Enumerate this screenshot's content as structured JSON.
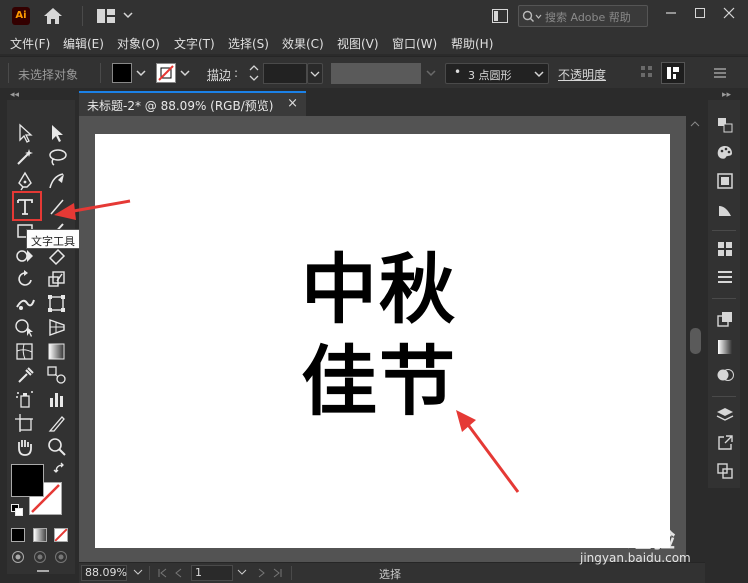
{
  "app": {
    "logo_text": "Ai"
  },
  "search": {
    "placeholder": "搜索 Adobe 帮助"
  },
  "menu": [
    "文件(F)",
    "编辑(E)",
    "对象(O)",
    "文字(T)",
    "选择(S)",
    "效果(C)",
    "视图(V)",
    "窗口(W)",
    "帮助(H)"
  ],
  "control_bar": {
    "selection_status": "未选择对象",
    "stroke_label": "描边",
    "stroke_separator": ":",
    "brush_label": "3 点圆形",
    "brush_dot": "•",
    "opacity_label": "不透明度"
  },
  "tooltip": {
    "text": "文字工具 (T)"
  },
  "document_tab": {
    "title": "未标题-2* @ 88.09% (RGB/预览)",
    "close": "×"
  },
  "artboard": {
    "line1": "中秋",
    "line2": "佳节"
  },
  "status_bar": {
    "zoom": "88.09%",
    "page": "1",
    "mode": "选择"
  },
  "watermark": {
    "text": "Bai 经验",
    "url": "jingyan.baidu.com"
  },
  "colors": {
    "accent_red": "#e53935",
    "brand_orange": "#ff9a00",
    "highlight_blue": "#1b81e7"
  },
  "icons": {
    "tools": [
      "selection-tool-icon",
      "direct-selection-tool-icon",
      "magic-wand-tool-icon",
      "lasso-tool-icon",
      "pen-tool-icon",
      "curvature-tool-icon",
      "type-tool-icon",
      "line-segment-tool-icon",
      "rectangle-tool-icon",
      "paintbrush-tool-icon",
      "shaper-tool-icon",
      "eraser-tool-icon",
      "rotate-tool-icon",
      "scale-tool-icon",
      "width-tool-icon",
      "free-transform-tool-icon",
      "shape-builder-tool-icon",
      "perspective-grid-tool-icon",
      "mesh-tool-icon",
      "gradient-tool-icon",
      "eyedropper-tool-icon",
      "blend-tool-icon",
      "symbol-sprayer-tool-icon",
      "column-graph-tool-icon",
      "artboard-tool-icon",
      "slice-tool-icon",
      "hand-tool-icon",
      "zoom-tool-icon"
    ],
    "right_panel": [
      "properties-icon",
      "color-icon",
      "swatches-icon",
      "stroke-icon",
      "libraries-icon",
      "align-icon",
      "transform-icon",
      "gradient-icon",
      "appearance-icon",
      "layers-icon",
      "export-icon",
      "artboards-icon"
    ]
  }
}
